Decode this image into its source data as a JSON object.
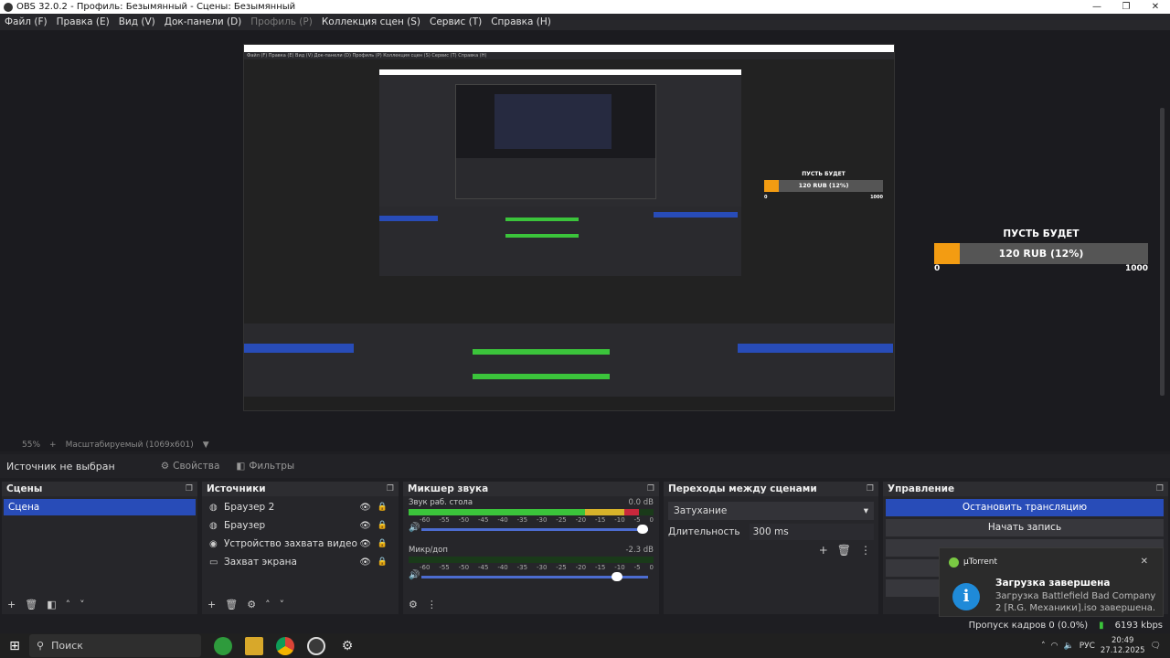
{
  "window": {
    "title": "OBS 32.0.2 - Профиль: Безымянный - Сцены: Безымянный",
    "controls": [
      "—",
      "❐",
      "✕"
    ]
  },
  "menu": [
    {
      "label": "Файл (F)",
      "disabled": false
    },
    {
      "label": "Правка (E)",
      "disabled": false
    },
    {
      "label": "Вид (V)",
      "disabled": false
    },
    {
      "label": "Док-панели (D)",
      "disabled": false
    },
    {
      "label": "Профиль (P)",
      "disabled": true
    },
    {
      "label": "Коллекция сцен (S)",
      "disabled": false
    },
    {
      "label": "Сервис (T)",
      "disabled": false
    },
    {
      "label": "Справка (H)",
      "disabled": false
    }
  ],
  "preview": {
    "widget": {
      "title": "ПУСТЬ БУДЕТ",
      "value_text": "120 RUB (12%)",
      "min": "0",
      "max": "1000",
      "progress_percent": 12
    },
    "nested_menu": "Файл (F)   Правка (E)   Вид (V)   Док-панели (D)   Профиль (P)   Коллекция сцен (S)   Сервис (T)   Справка (H)"
  },
  "zoom": {
    "level": "55%",
    "plus": "+",
    "mode": "Масштабируемый (1069x601)",
    "dropdown": "▼"
  },
  "source_bar": {
    "no_source": "Источник не выбран",
    "properties": "Свойства",
    "filters": "Фильтры"
  },
  "docks": {
    "scenes": {
      "title": "Сцены",
      "items": [
        "Сцена"
      ]
    },
    "sources": {
      "title": "Источники",
      "items": [
        {
          "icon": "browser-icon",
          "glyph": "◍",
          "label": "Браузер 2"
        },
        {
          "icon": "browser-icon",
          "glyph": "◍",
          "label": "Браузер"
        },
        {
          "icon": "camera-icon",
          "glyph": "◉",
          "label": "Устройство захвата видео"
        },
        {
          "icon": "monitor-icon",
          "glyph": "▭",
          "label": "Захват экрана"
        }
      ]
    },
    "mixer": {
      "title": "Микшер звука",
      "channels": [
        {
          "name": "Звук раб. стола",
          "db": "0.0 dB",
          "level_percent": 94,
          "volume_percent": 100
        },
        {
          "name": "Микр/доп",
          "db": "-2.3 dB",
          "level_percent": 0,
          "volume_percent": 88
        }
      ],
      "ticks": [
        "-60",
        "-55",
        "-50",
        "-45",
        "-40",
        "-35",
        "-30",
        "-25",
        "-20",
        "-15",
        "-10",
        "-5",
        "0"
      ]
    },
    "transitions": {
      "title": "Переходы между сценами",
      "selected": "Затухание",
      "duration_label": "Длительность",
      "duration_value": "300 ms"
    },
    "controls": {
      "title": "Управление",
      "stop_stream": "Остановить трансляцию",
      "start_record": "Начать запись"
    }
  },
  "toast": {
    "app": "µTorrent",
    "title": "Загрузка завершена",
    "body": "Загрузка Battlefield Bad Company 2 [R.G. Механики].iso завершена."
  },
  "status": {
    "dropped": "Пропуск кадров 0 (0.0%)",
    "bitrate": "6193 kbps"
  },
  "taskbar": {
    "search": "Поиск",
    "lang": "РУС",
    "time": "20:49",
    "date": "27.12.2025"
  },
  "colors": {
    "accent": "#284cb8",
    "widget_fill": "#f39c12",
    "meter_green": "#3bc43b"
  }
}
